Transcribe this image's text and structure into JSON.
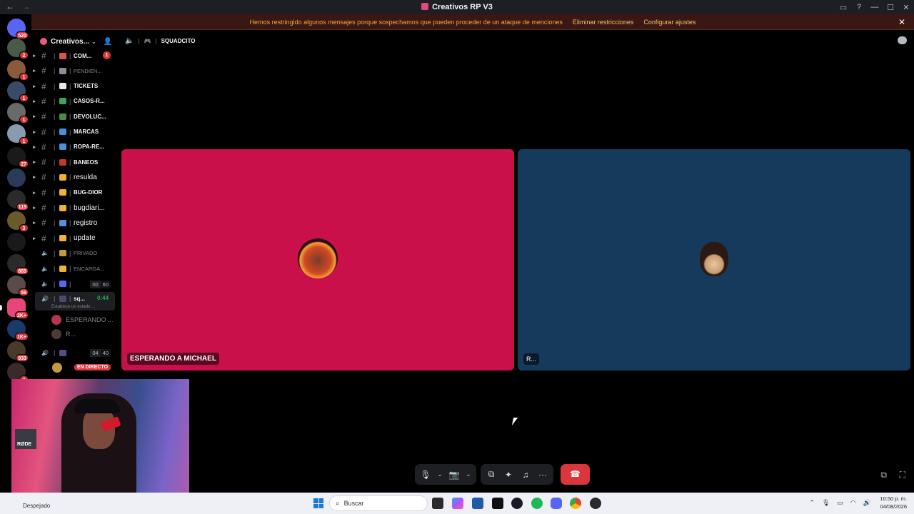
{
  "window": {
    "back": "←",
    "forward": "→",
    "title": "Creativos RP V3",
    "controls": [
      "▭",
      "?",
      "—",
      "☐",
      "✕"
    ]
  },
  "banner": {
    "message": "Hemos restringido algunos mensajes porque sospechamos que pueden proceder de un ataque de menciones",
    "remove_label": "Eliminar restricciones",
    "settings_label": "Configurar ajustes",
    "close": "✕"
  },
  "rail": {
    "servers": [
      {
        "badge": "520",
        "color": "#5865f2"
      },
      {
        "badge": "2",
        "color": "#4a5a4a"
      },
      {
        "badge": "1",
        "color": "#8a5a3a"
      },
      {
        "badge": "1",
        "color": "#3a4a6a"
      },
      {
        "badge": "1",
        "color": "#6a6a6a"
      },
      {
        "badge": "1",
        "color": "#8a9ab0"
      },
      {
        "badge": "27",
        "color": "#1a1a1a"
      },
      {
        "badge": "",
        "color": "#2a3a5a"
      },
      {
        "badge": "115",
        "color": "#2a2a2a"
      },
      {
        "badge": "3",
        "color": "#6a5a2a"
      },
      {
        "badge": "",
        "color": "#1a1a1a"
      },
      {
        "badge": "865",
        "color": "#2a2a2a"
      },
      {
        "badge": "59",
        "color": "#5a4a4a"
      },
      {
        "badge": "2K+",
        "color": "#e8457a"
      },
      {
        "badge": "1K+",
        "color": "#1a3a6a"
      },
      {
        "badge": "933",
        "color": "#4a3a2a"
      },
      {
        "badge": "2",
        "color": "#3a2a2a"
      }
    ]
  },
  "sidebar": {
    "guild_name": "Creativos...",
    "chevron": "⌄",
    "channels": [
      {
        "label": "COM...",
        "emoji_color": "#d9534f",
        "count": "1",
        "style": "normal"
      },
      {
        "label": "PENDIEN...",
        "emoji_color": "#8a8f98",
        "count": "",
        "style": "dim"
      },
      {
        "label": "TICKETS",
        "emoji_color": "#e8e8e8",
        "count": "",
        "style": "normal"
      },
      {
        "label": "CASOS-R...",
        "emoji_color": "#3ba55c",
        "count": "",
        "style": "normal"
      },
      {
        "label": "DEVOLUC...",
        "emoji_color": "#4a8a4a",
        "count": "",
        "style": "normal"
      },
      {
        "label": "MARCAS",
        "emoji_color": "#4a90d9",
        "count": "",
        "style": "normal"
      },
      {
        "label": "ROPA-RE...",
        "emoji_color": "#4a90d9",
        "count": "",
        "style": "normal"
      },
      {
        "label": "BANEOS",
        "emoji_color": "#c0392b",
        "count": "",
        "style": "normal"
      },
      {
        "label": "resulda",
        "emoji_color": "#f0b232",
        "count": "",
        "style": "big"
      },
      {
        "label": "BUG-DIOR",
        "emoji_color": "#f0b232",
        "count": "",
        "style": "normal"
      },
      {
        "label": "bugdiari...",
        "emoji_color": "#f0b232",
        "count": "",
        "style": "big"
      },
      {
        "label": "registro",
        "emoji_color": "#5a8fd9",
        "count": "",
        "style": "big"
      },
      {
        "label": "update",
        "emoji_color": "#f0b232",
        "count": "",
        "style": "big"
      }
    ],
    "voice_channels": [
      {
        "label": "PRIVADO",
        "emoji_color": "#c49a3a"
      },
      {
        "label": "ENCARGA...",
        "emoji_color": "#f0b232"
      }
    ],
    "voice_room_1": {
      "counts": [
        "00",
        "60"
      ]
    },
    "current_voice": {
      "label": "sq...",
      "timer": "0:44",
      "status": "Establece un estado ..."
    },
    "users": [
      {
        "name": "ESPERANDO ...",
        "color": "#b5364f"
      },
      {
        "name": "R...",
        "color": "#4a3a3a"
      }
    ],
    "voice_room_2": {
      "counts": [
        "04",
        "40"
      ]
    },
    "live_label": "EN DIRECTO"
  },
  "channel_header": {
    "name": "SQUADCITO"
  },
  "tiles": [
    {
      "name": "ESPERANDO A MICHAEL",
      "bg": "#c9104a"
    },
    {
      "name": "R...",
      "bg": "#163a5c"
    }
  ],
  "controls": {
    "mic": "🎙",
    "camera": "📷",
    "share": "⧉",
    "activities": "✦",
    "soundboard": "♫",
    "more": "···",
    "hangup": "☎"
  },
  "taskbar": {
    "weather": "Despejado",
    "search_placeholder": "Buscar",
    "time": "10:50 p. m.",
    "date": "04/08/2026"
  }
}
